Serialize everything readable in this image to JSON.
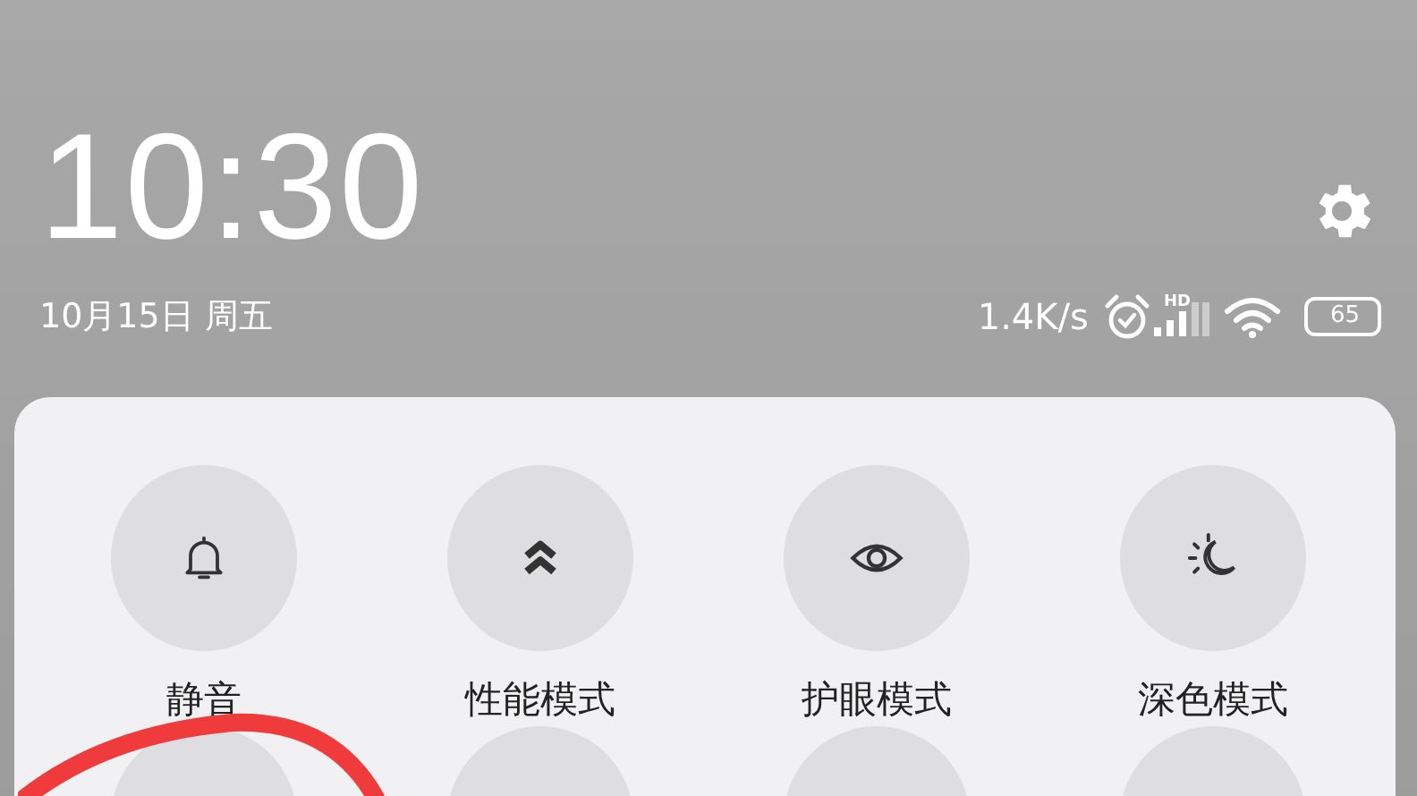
{
  "clock": {
    "time": "10:30",
    "date": "10月15日 周五"
  },
  "status_bar": {
    "network_speed": "1.4K/s",
    "network_type": "HD",
    "battery": "65"
  },
  "tiles": [
    {
      "label": "静音"
    },
    {
      "label": "性能模式"
    },
    {
      "label": "护眼模式"
    },
    {
      "label": "深色模式"
    }
  ]
}
